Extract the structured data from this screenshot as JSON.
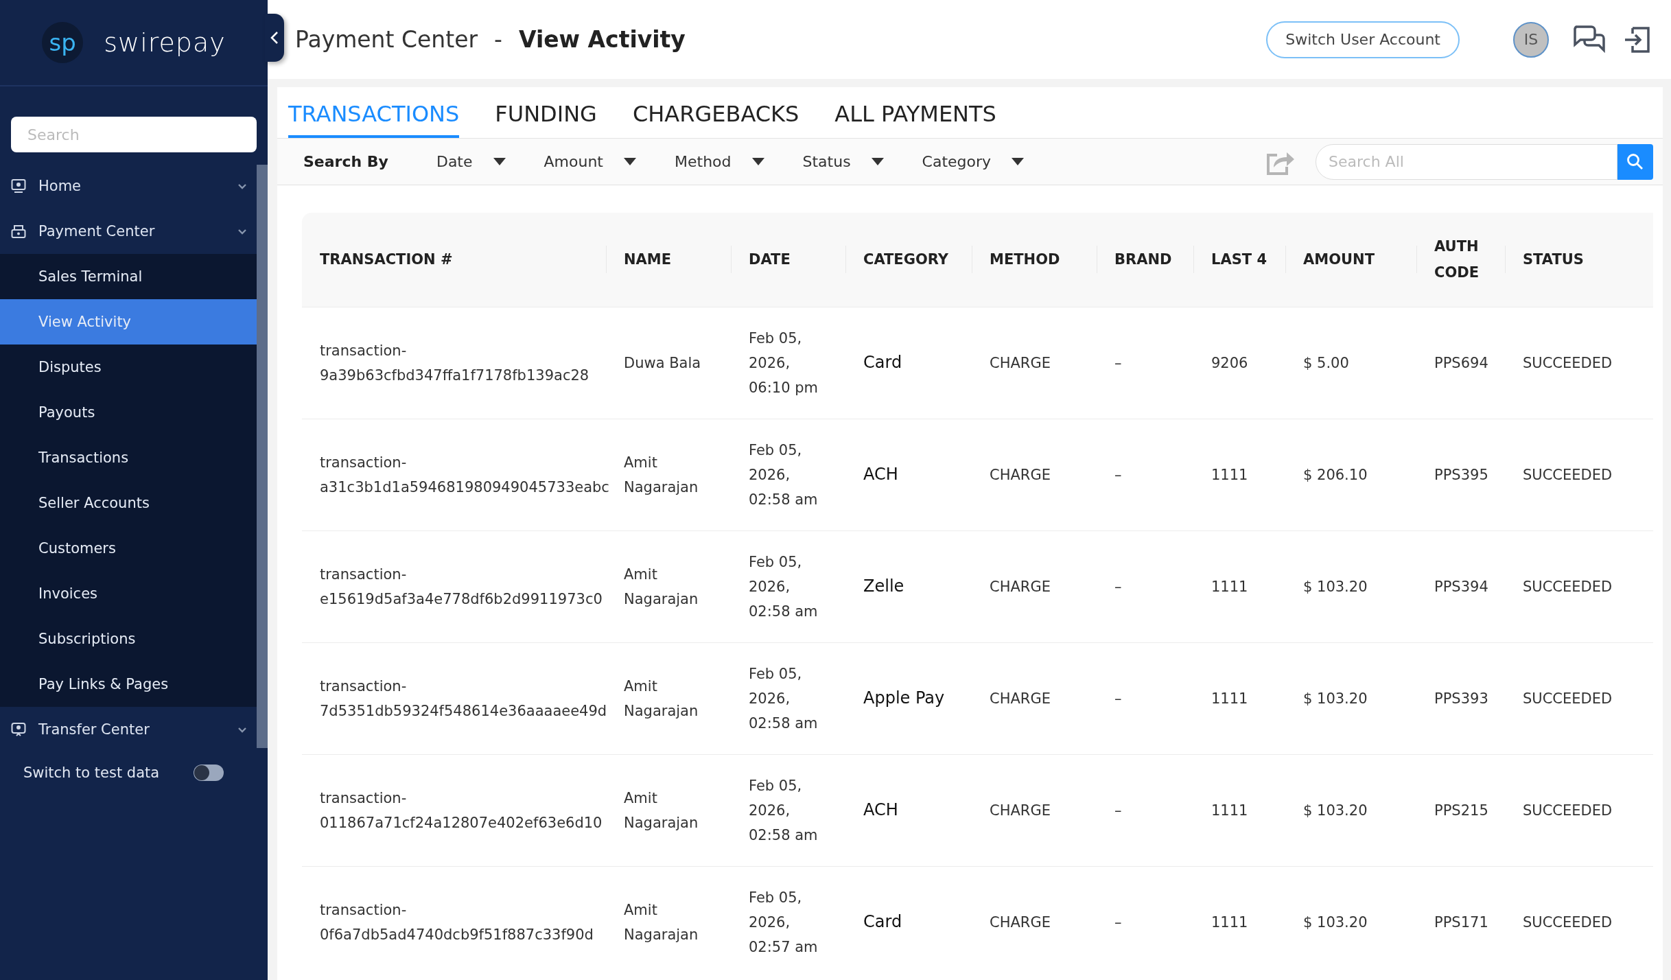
{
  "brand": {
    "mark": "sp",
    "name": "swirepay"
  },
  "sidebar": {
    "search": {
      "placeholder": "Search"
    },
    "items": [
      {
        "label": "Home"
      },
      {
        "label": "Payment Center",
        "children": [
          {
            "label": "Sales Terminal",
            "selected": false
          },
          {
            "label": "View Activity",
            "selected": true
          },
          {
            "label": "Disputes",
            "selected": false
          },
          {
            "label": "Payouts",
            "selected": false
          },
          {
            "label": "Transactions",
            "selected": false
          },
          {
            "label": "Seller Accounts",
            "selected": false
          },
          {
            "label": "Customers",
            "selected": false
          },
          {
            "label": "Invoices",
            "selected": false
          },
          {
            "label": "Subscriptions",
            "selected": false
          },
          {
            "label": "Pay Links & Pages",
            "selected": false
          }
        ]
      },
      {
        "label": "Transfer Center"
      }
    ],
    "test_toggle": {
      "label": "Switch to test data",
      "on": false
    }
  },
  "header": {
    "section": "Payment Center",
    "separator": "-",
    "page": "View Activity",
    "switch_button": "Switch User Account",
    "avatar": "IS"
  },
  "tabs": [
    {
      "label": "TRANSACTIONS",
      "selected": true
    },
    {
      "label": "FUNDING",
      "selected": false
    },
    {
      "label": "CHARGEBACKS",
      "selected": false
    },
    {
      "label": "ALL PAYMENTS",
      "selected": false
    }
  ],
  "filters": {
    "label": "Search By",
    "dropdowns": [
      "Date",
      "Amount",
      "Method",
      "Status",
      "Category"
    ],
    "search": {
      "placeholder": "Search All"
    }
  },
  "table": {
    "columns": [
      "TRANSACTION #",
      "NAME",
      "DATE",
      "CATEGORY",
      "METHOD",
      "BRAND",
      "LAST 4",
      "AMOUNT",
      "AUTH CODE",
      "STATUS"
    ],
    "rows": [
      [
        "transaction-9a39b63cfbd347ffa1f7178fb139ac28",
        "Duwa Bala",
        "Feb 05, 2026, 06:10 pm",
        "Card",
        "CHARGE",
        "–",
        "9206",
        "$ 5.00",
        "PPS694",
        "SUCCEEDED"
      ],
      [
        "transaction-a31c3b1d1a594681980949045733eabc",
        "Amit Nagarajan",
        "Feb 05, 2026, 02:58 am",
        "ACH",
        "CHARGE",
        "–",
        "1111",
        "$ 206.10",
        "PPS395",
        "SUCCEEDED"
      ],
      [
        "transaction-e15619d5af3a4e778df6b2d9911973c0",
        "Amit Nagarajan",
        "Feb 05, 2026, 02:58 am",
        "Zelle",
        "CHARGE",
        "–",
        "1111",
        "$ 103.20",
        "PPS394",
        "SUCCEEDED"
      ],
      [
        "transaction-7d5351db59324f548614e36aaaaee49d",
        "Amit Nagarajan",
        "Feb 05, 2026, 02:58 am",
        "Apple Pay",
        "CHARGE",
        "–",
        "1111",
        "$ 103.20",
        "PPS393",
        "SUCCEEDED"
      ],
      [
        "transaction-011867a71cf24a12807e402ef63e6d10",
        "Amit Nagarajan",
        "Feb 05, 2026, 02:58 am",
        "ACH",
        "CHARGE",
        "–",
        "1111",
        "$ 103.20",
        "PPS215",
        "SUCCEEDED"
      ],
      [
        "transaction-0f6a7db5ad4740dcb9f51f887c33f90d",
        "Amit Nagarajan",
        "Feb 05, 2026, 02:57 am",
        "Card",
        "CHARGE",
        "–",
        "1111",
        "$ 103.20",
        "PPS171",
        "SUCCEEDED"
      ]
    ]
  }
}
